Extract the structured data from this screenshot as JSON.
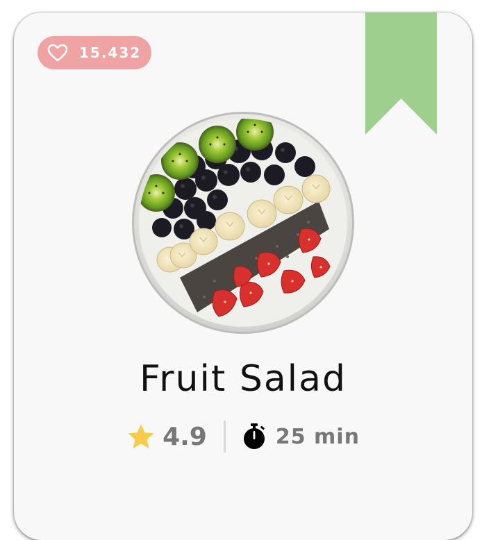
{
  "card": {
    "likes": "15.432",
    "title": "Fruit Salad",
    "rating": "4.9",
    "duration": "25 min"
  },
  "icons": {
    "likes": "heart-outline-icon",
    "bookmark": "bookmark-ribbon-icon",
    "rating": "star-icon",
    "duration": "stopwatch-icon"
  },
  "colors": {
    "card_background": "#f8f8f8",
    "likes_badge": "#f0a3a3",
    "bookmark": "#9fcf8f",
    "star": "#f8cc4a",
    "title_text": "#111111",
    "meta_text": "#777777"
  }
}
